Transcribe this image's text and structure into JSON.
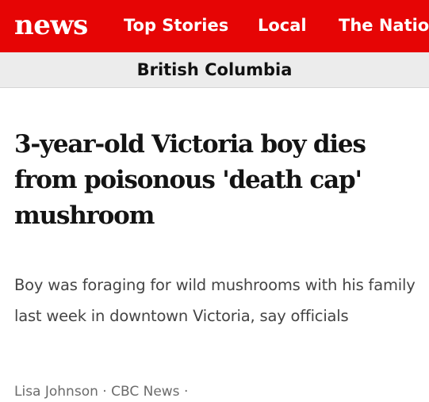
{
  "nav": {
    "logo": "news",
    "links": [
      "Top Stories",
      "Local",
      "The Natio"
    ],
    "bg_color": "#e60505"
  },
  "section": {
    "title": "British Columbia"
  },
  "article": {
    "headline": "3-year-old Victoria boy dies from poisonous 'death cap' mushroom",
    "dek": "Boy was foraging for wild mushrooms with his family last week in downtown Victoria, say officials",
    "byline": {
      "author": "Lisa Johnson",
      "separator": " · ",
      "source": "CBC News",
      "trailing": " ·"
    }
  }
}
